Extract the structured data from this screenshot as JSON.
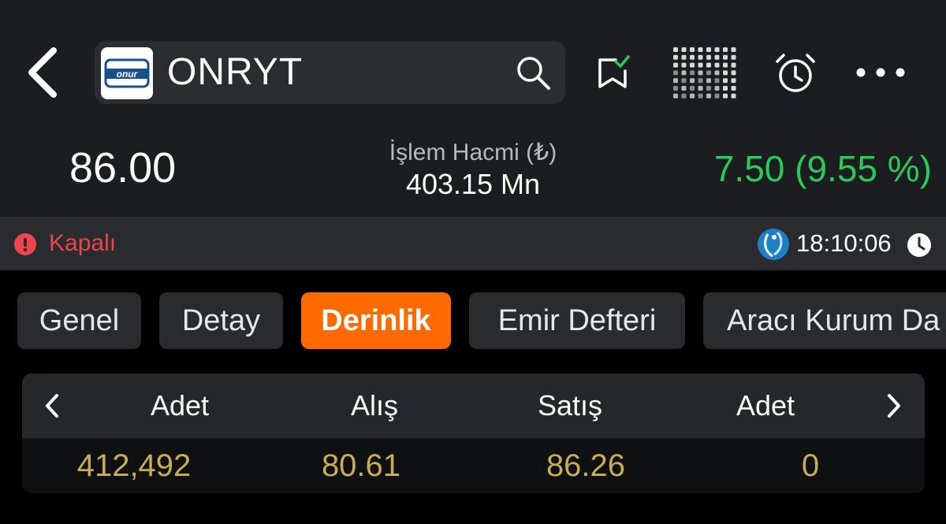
{
  "header": {
    "symbol": "ONRYT",
    "logo_text": "onur"
  },
  "quote": {
    "price": "86.00",
    "volume_label": "İşlem Hacmi (₺)",
    "volume_value": "403.15 Mn",
    "change": "7.50 (9.55 %)"
  },
  "status": {
    "state": "Kapalı",
    "time": "18:10:06"
  },
  "tabs": [
    {
      "label": "Genel"
    },
    {
      "label": "Detay"
    },
    {
      "label": "Derinlik"
    },
    {
      "label": "Emir Defteri"
    },
    {
      "label": "Aracı Kurum Da"
    }
  ],
  "depth_table": {
    "columns": [
      "Adet",
      "Alış",
      "Satış",
      "Adet"
    ],
    "rows": [
      [
        "412,492",
        "80.61",
        "86.26",
        "0"
      ]
    ]
  },
  "colors": {
    "accent": "#ff6a00",
    "positive": "#2bc95a",
    "closed": "#f0444b",
    "depth_value": "#c9ad55"
  }
}
